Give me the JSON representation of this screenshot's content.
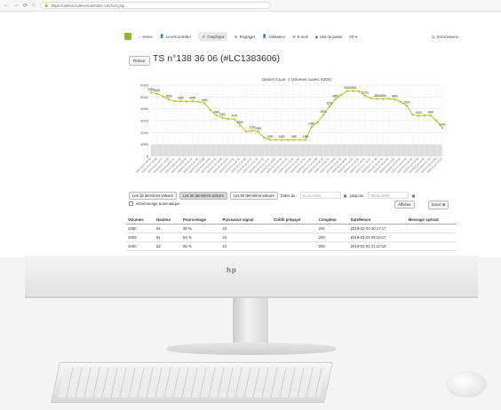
{
  "browser": {
    "url": "https://utsfres.eu/levelcontroller-v4/chart.php",
    "nav_icons": {
      "back": "←",
      "forward": "→",
      "reload": "⟳",
      "home": "⌂"
    }
  },
  "site_nav": {
    "items": [
      {
        "icon": "home-icon",
        "label": "Home"
      },
      {
        "icon": "user-icon",
        "label": "LevelController"
      },
      {
        "icon": "chart-icon",
        "label": "Graphique",
        "active": true
      },
      {
        "icon": "gear-icon",
        "label": "Réglages"
      },
      {
        "icon": "user-icon",
        "label": "Utilisateur"
      },
      {
        "icon": "mail-icon",
        "label": "E-mail"
      },
      {
        "icon": "eye-icon",
        "label": "Mot de passe"
      },
      {
        "icon": "",
        "label": "FR ▾"
      }
    ],
    "logout": "Déconnexion"
  },
  "page": {
    "back_label": "Retour",
    "title": "TS n°138 36 06 (#LC1383606)"
  },
  "chart_data": {
    "type": "line",
    "title": "Diesel (Cuve: 1 Volumes cuves: 6200)",
    "ylim": [
      0,
      6000
    ],
    "yticks": [
      0,
      1000,
      2000,
      3000,
      4000,
      5000,
      6000
    ],
    "x": [
      "2019-01-07 08:05",
      "2019-01-07 10:28",
      "2019-01-07 16:47",
      "2019-01-07 21:00",
      "2019-01-08 05:12",
      "2019-01-08 12:42",
      "2019-01-08 18:33",
      "2019-01-09 01:24",
      "2019-01-09 07:50",
      "2019-01-09 14:15",
      "2019-01-09 19:06",
      "2019-01-10 03:32",
      "2019-01-10 10:05",
      "2019-01-10 16:11",
      "2019-01-10 23:41",
      "2019-01-11 06:37",
      "2019-01-11 11:26",
      "2019-01-11 18:23",
      "2019-01-12 01:24",
      "2019-01-12 07:45",
      "2019-01-12 13:37",
      "2019-01-12 19:15",
      "2019-01-13 02:46",
      "2019-01-13 09:37",
      "2019-01-13 15:18",
      "2019-01-13 22:04",
      "2019-01-14 06:54",
      "2019-01-14 13:36",
      "2019-01-14 21:09",
      "2019-01-15 05:22",
      "2019-01-15 11:52",
      "2019-01-15 18:03",
      "2019-01-16 01:14",
      "2019-01-16 08:25",
      "2019-01-16 14:36",
      "2019-01-16 21:09",
      "2019-01-17 04:52",
      "2019-01-17 10:17",
      "2019-01-17 17:38",
      "2019-01-18 00:10",
      "2019-01-18 07:25",
      "2019-01-18 13:51",
      "2019-01-18 19:40",
      "2019-01-19 03:18",
      "2019-01-19 10:26",
      "2019-01-19 16:33",
      "2019-01-19 23:58",
      "2019-01-20 07:12",
      "2019-01-20 12:49",
      "2019-01-20 19:23"
    ],
    "values": [
      5380,
      5280,
      5050,
      4800,
      4650,
      4650,
      4620,
      4650,
      4600,
      4480,
      3900,
      3440,
      3260,
      3150,
      3140,
      2600,
      2100,
      2160,
      2080,
      1580,
      1390,
      1380,
      1380,
      1390,
      1380,
      1380,
      1390,
      2480,
      2860,
      3500,
      4200,
      4800,
      5200,
      5520,
      5520,
      5480,
      5100,
      4900,
      4850,
      4850,
      4850,
      4800,
      4600,
      4280,
      3500,
      3420,
      3440,
      3460,
      3000,
      2400
    ],
    "data_labels": [
      {
        "i": 0,
        "text": "5380"
      },
      {
        "i": 1,
        "text": "5280"
      },
      {
        "i": 3,
        "text": "4800"
      },
      {
        "i": 5,
        "text": "4650"
      },
      {
        "i": 7,
        "text": "4650"
      },
      {
        "i": 9,
        "text": "4480"
      },
      {
        "i": 11,
        "text": "3440"
      },
      {
        "i": 12,
        "text": "3260"
      },
      {
        "i": 14,
        "text": "3140"
      },
      {
        "i": 15,
        "text": "2600"
      },
      {
        "i": 17,
        "text": "2160"
      },
      {
        "i": 18,
        "text": "2080"
      },
      {
        "i": 20,
        "text": "1380"
      },
      {
        "i": 22,
        "text": "1380"
      },
      {
        "i": 24,
        "text": "1380"
      },
      {
        "i": 26,
        "text": "1380"
      },
      {
        "i": 27,
        "text": "2480"
      },
      {
        "i": 29,
        "text": "3500"
      },
      {
        "i": 30,
        "text": "4200"
      },
      {
        "i": 31,
        "text": "4800"
      },
      {
        "i": 33,
        "text": "5520"
      },
      {
        "i": 34,
        "text": "5520"
      },
      {
        "i": 36,
        "text": "5100"
      },
      {
        "i": 38,
        "text": "4850"
      },
      {
        "i": 39,
        "text": "4850"
      },
      {
        "i": 41,
        "text": "4800"
      },
      {
        "i": 43,
        "text": "3500"
      },
      {
        "i": 45,
        "text": "3440"
      },
      {
        "i": 47,
        "text": "3460"
      },
      {
        "i": 49,
        "text": "2400"
      }
    ],
    "line_color": "#b4cc18",
    "marker_color": "#c8d64a",
    "grid": true,
    "legend": "none"
  },
  "controls": {
    "btn10": "Les 10 dernières valeurs",
    "btn30": "Les 30 dernières valeurs",
    "btn60": "Les 60 dernières valeurs",
    "dates_label": "Dates du :",
    "date_from": "01-01-2019",
    "to_label": "jusqu'au :",
    "date_to": "03-01-2019",
    "autoscale": "échelonnage automatique",
    "afficher": "Afficher",
    "excel": "Excel"
  },
  "table": {
    "headers": [
      "Volumes",
      "Hauteur",
      "Pourcentage",
      "Puissance signal",
      "Crédit prépayé",
      "Compteur",
      "Date/Heure",
      "Message spécial"
    ],
    "rows": [
      [
        "2260",
        "61",
        "38 %",
        "22",
        "",
        "201",
        "2019-01-03 10:17:17",
        ""
      ],
      [
        "3400",
        "91",
        "54 %",
        "22",
        "",
        "200",
        "2019-01-03 09:10:17",
        ""
      ],
      [
        "3460",
        "62",
        "66 %",
        "21",
        "",
        "200",
        "2019-01-02 21:10:19",
        ""
      ]
    ]
  }
}
